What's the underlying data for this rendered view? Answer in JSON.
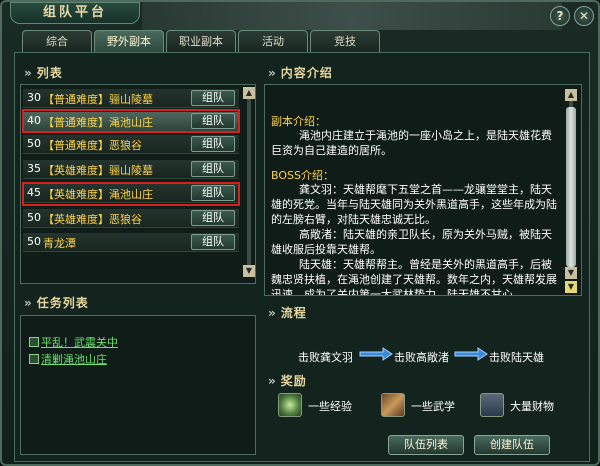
{
  "window": {
    "title": "组队平台",
    "help_label": "?",
    "close_label": "✕"
  },
  "tabs": [
    {
      "label": "综合"
    },
    {
      "label": "野外副本"
    },
    {
      "label": "职业副本"
    },
    {
      "label": "活动"
    },
    {
      "label": "竞技"
    }
  ],
  "list": {
    "title": "列表",
    "button_label": "组队",
    "rows": [
      {
        "level": "30",
        "name": "【普通难度】骊山陵墓"
      },
      {
        "level": "40",
        "name": "【普通难度】渑池山庄"
      },
      {
        "level": "50",
        "name": "【普通难度】恶狼谷"
      },
      {
        "level": "35",
        "name": "【英雄难度】骊山陵墓"
      },
      {
        "level": "45",
        "name": "【英雄难度】渑池山庄"
      },
      {
        "level": "50",
        "name": "【英雄难度】恶狼谷"
      },
      {
        "level": "50",
        "name": "青龙潭"
      }
    ]
  },
  "tasks": {
    "title": "任务列表",
    "items": [
      {
        "label": "平乱！武震关中"
      },
      {
        "label": "清剿渑池山庄"
      }
    ]
  },
  "description": {
    "title": "内容介绍",
    "intro_heading": "副本介绍：",
    "intro_text": "渑池内庄建立于渑池的一座小岛之上，是陆天雄花费巨资为自己建造的居所。",
    "boss_heading": "BOSS介绍：",
    "boss_paras": [
      "龚文羽：天雄帮麾下五堂之首——龙骧堂堂主，陆天雄的死党。当年与陆天雄同为关外黑道高手，这些年成为陆的左膀右臂，对陆天雄忠诚无比。",
      "高敞渚：陆天雄的亲卫队长，原为关外马贼，被陆天雄收服后投靠天雄帮。",
      "陆天雄：天雄帮帮主。曾经是关外的黑道高手，后被魏忠贤扶植，在渑池创建了天雄帮。数年之内，天雄帮发展迅速，成为了关内第一大武林势力。陆天雄不甘心"
    ]
  },
  "flow": {
    "title": "流程",
    "steps": [
      "击败龚文羽",
      "击败高敞渚",
      "击败陆天雄"
    ]
  },
  "rewards": {
    "title": "奖励",
    "items": [
      {
        "label": "一些经验",
        "icon": "experience-orb-icon"
      },
      {
        "label": "一些武学",
        "icon": "martial-scroll-icon"
      },
      {
        "label": "大量财物",
        "icon": "treasure-chest-icon"
      }
    ]
  },
  "buttons": {
    "team_list": "队伍列表",
    "create_team": "创建队伍"
  },
  "colors": {
    "highlight_box": "#d92020",
    "item_name": "#ffd54a",
    "task_link": "#6fe06f"
  }
}
